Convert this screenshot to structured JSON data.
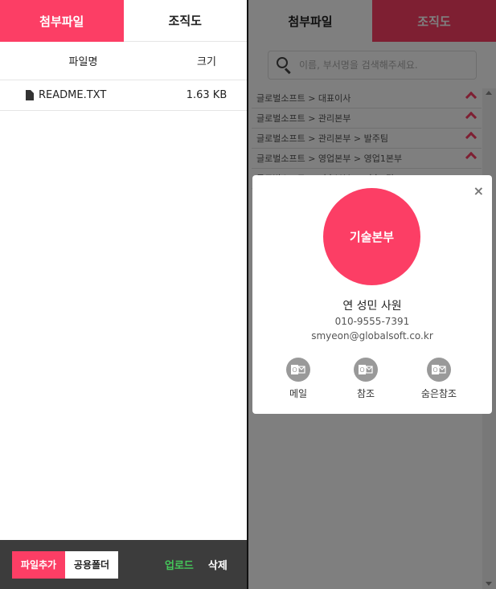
{
  "left": {
    "tabs": [
      "첨부파일",
      "조직도"
    ],
    "table": {
      "headers": [
        "파일명",
        "크기"
      ],
      "rows": [
        {
          "name": "README.TXT",
          "size": "1.63 KB"
        }
      ]
    },
    "footer": {
      "add_file": "파일추가",
      "shared_folder": "공용폴더",
      "upload": "업로드",
      "delete": "삭제"
    }
  },
  "right": {
    "tabs": [
      "첨부파일",
      "조직도"
    ],
    "search": {
      "placeholder": "이름, 부서명을 검색해주세요."
    },
    "org_list": [
      "글로벌소프트 > 대표이사",
      "글로벌소프트 > 관리본부",
      "글로벌소프트 > 관리본부 > 발주팀",
      "글로벌소프트 > 영업본부 > 영업1본부",
      "글로벌소프트 > 기술본부 > 기술1팀"
    ]
  },
  "modal": {
    "close": "×",
    "department": "기술본부",
    "name": "연 성민 사원",
    "phone": "010-9555-7391",
    "email": "smyeon@globalsoft.co.kr",
    "actions": [
      "메일",
      "참조",
      "숨은참조"
    ]
  },
  "colors": {
    "accent": "#fc3e65",
    "upload": "#45c85a",
    "footer_bg": "#3c3c3c"
  }
}
